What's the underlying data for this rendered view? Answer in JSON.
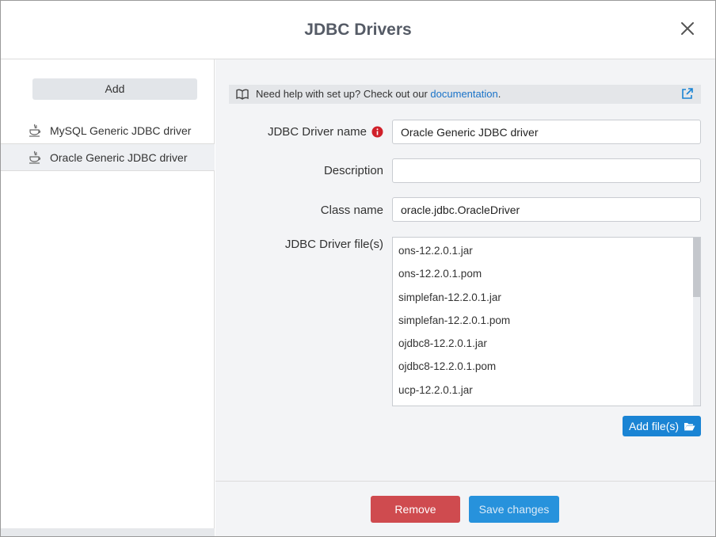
{
  "dialog": {
    "title": "JDBC Drivers"
  },
  "sidebar": {
    "add_label": "Add",
    "items": [
      {
        "label": "MySQL Generic JDBC driver",
        "icon": "java-icon",
        "selected": false
      },
      {
        "label": "Oracle Generic JDBC driver",
        "icon": "java-icon",
        "selected": true
      }
    ]
  },
  "help": {
    "text": "Need help with set up? Check out our ",
    "link_text": "documentation",
    "suffix": "."
  },
  "form": {
    "name_label": "JDBC Driver name",
    "name_value": "Oracle Generic JDBC driver",
    "description_label": "Description",
    "description_value": "",
    "class_label": "Class name",
    "class_value": "oracle.jdbc.OracleDriver",
    "files_label": "JDBC Driver file(s)",
    "files": [
      "ons-12.2.0.1.jar",
      "ons-12.2.0.1.pom",
      "simplefan-12.2.0.1.jar",
      "simplefan-12.2.0.1.pom",
      "ojdbc8-12.2.0.1.jar",
      "ojdbc8-12.2.0.1.pom",
      "ucp-12.2.0.1.jar"
    ],
    "add_files_label": "Add file(s)"
  },
  "footer": {
    "remove_label": "Remove",
    "save_label": "Save changes"
  },
  "colors": {
    "accent": "#1a84d4",
    "danger": "#cf4b4f",
    "link": "#1a73c8",
    "info": "#d0202a"
  }
}
